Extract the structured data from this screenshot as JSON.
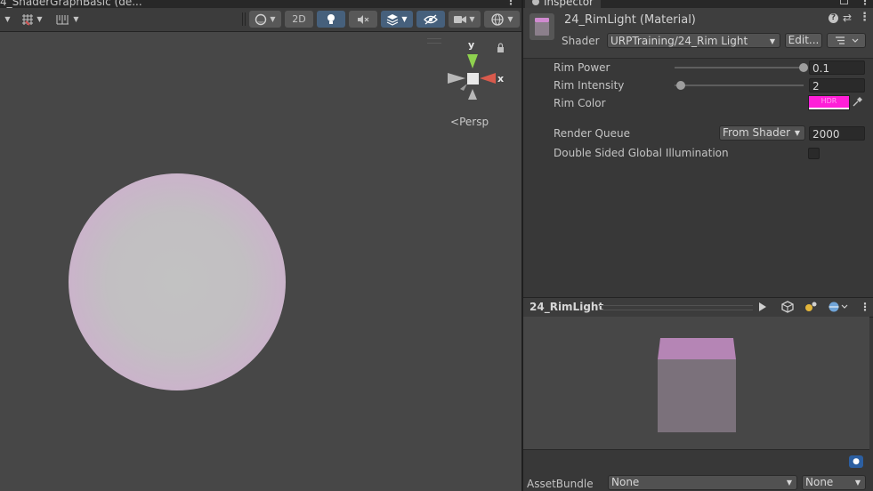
{
  "scene": {
    "title": "4_ShaderGraphBasic (de...",
    "toolbar": {
      "two_d_label": "2D"
    },
    "persp_label": "Persp",
    "gizmo": {
      "y_label": "y",
      "x_label": "x"
    }
  },
  "inspector": {
    "tab_label": "Inspector",
    "material_title": "24_RimLight (Material)",
    "shader_label": "Shader",
    "shader_value": "URPTraining/24_Rim Light",
    "edit_label": "Edit...",
    "properties": {
      "rim_power": {
        "label": "Rim Power",
        "value": "0.1",
        "slider_fraction": 1.0
      },
      "rim_intensity": {
        "label": "Rim Intensity",
        "value": "2",
        "slider_fraction": 0.05
      },
      "rim_color": {
        "label": "Rim Color",
        "color": "#ff1fd8",
        "badge": "HDR"
      }
    },
    "render_queue": {
      "label": "Render Queue",
      "dropdown": "From Shader",
      "value": "2000"
    },
    "double_sided_gi": {
      "label": "Double Sided Global Illumination",
      "checked": false
    },
    "preview": {
      "title": "24_RimLight"
    },
    "asset_bundle": {
      "label": "AssetBundle",
      "name": "None",
      "variant": "None"
    }
  },
  "colors": {
    "accent_active": "#46607c",
    "rim_magenta": "#ff1fd8",
    "tag_blue": "#2c5fa1"
  }
}
